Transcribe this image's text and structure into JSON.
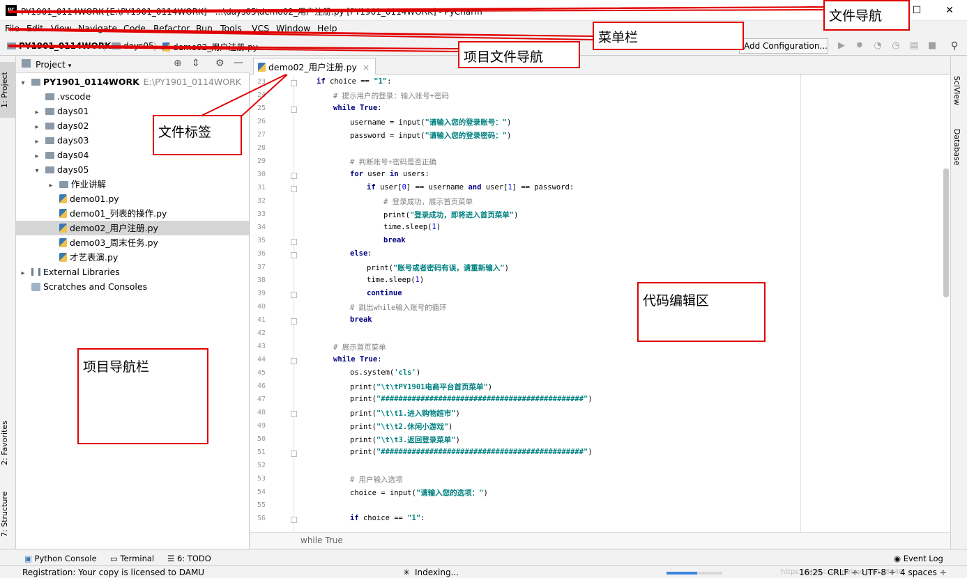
{
  "titlebar": {
    "logo": "PC",
    "title": "PY1901_0114WORK [E:\\PY1901_0114WORK] - ...\\days05\\demo02_用户注册.py [PY1901_0114WORK] - PyCharm",
    "minimize": "—",
    "maximize": "☐",
    "close": "✕"
  },
  "menu": [
    "File",
    "Edit",
    "View",
    "Navigate",
    "Code",
    "Refactor",
    "Run",
    "Tools",
    "VCS",
    "Window",
    "Help"
  ],
  "navbar": {
    "crumbs": [
      "PY1901_0114WORK",
      "days05",
      "demo02_用户注册.py"
    ],
    "run_config": "Add Configuration...",
    "icons": [
      "run-icon",
      "debug-icon",
      "coverage-icon",
      "profile-icon",
      "concurrency-icon",
      "stop-icon",
      "search-icon"
    ]
  },
  "left_stripe": {
    "project_tab": "1: Project",
    "favorites_tab": "2: Favorites",
    "structure_tab": "7: Structure"
  },
  "project": {
    "header_label": "Project",
    "tree": [
      {
        "label": "PY1901_0114WORK",
        "hint": "E:\\PY1901_0114WORK",
        "depth": 0,
        "arrow": "▾",
        "icon": "folder"
      },
      {
        "label": ".vscode",
        "depth": 1,
        "arrow": "",
        "icon": "folder"
      },
      {
        "label": "days01",
        "depth": 1,
        "arrow": "▸",
        "icon": "folder"
      },
      {
        "label": "days02",
        "depth": 1,
        "arrow": "▸",
        "icon": "folder"
      },
      {
        "label": "days03",
        "depth": 1,
        "arrow": "▸",
        "icon": "folder"
      },
      {
        "label": "days04",
        "depth": 1,
        "arrow": "▸",
        "icon": "folder"
      },
      {
        "label": "days05",
        "depth": 1,
        "arrow": "▾",
        "icon": "folder"
      },
      {
        "label": "作业讲解",
        "depth": 2,
        "arrow": "▸",
        "icon": "folder"
      },
      {
        "label": "demo01.py",
        "depth": 2,
        "arrow": "",
        "icon": "py"
      },
      {
        "label": "demo01_列表的操作.py",
        "depth": 2,
        "arrow": "",
        "icon": "py"
      },
      {
        "label": "demo02_用户注册.py",
        "depth": 2,
        "arrow": "",
        "icon": "py",
        "selected": true
      },
      {
        "label": "demo03_周末任务.py",
        "depth": 2,
        "arrow": "",
        "icon": "py"
      },
      {
        "label": "才艺表演.py",
        "depth": 2,
        "arrow": "",
        "icon": "py"
      },
      {
        "label": "External Libraries",
        "depth": 0,
        "arrow": "▸",
        "icon": "lib"
      },
      {
        "label": "Scratches and Consoles",
        "depth": 0,
        "arrow": "",
        "icon": "scratch"
      }
    ]
  },
  "editor": {
    "tab_label": "demo02_用户注册.py",
    "tab_close": "×",
    "breadcrumb": "while True",
    "lines": [
      {
        "n": "23",
        "ind": 4,
        "html": "<span class=\"kw\">if</span> choice == <span class=\"str\">\"1\"</span>:"
      },
      {
        "n": "24",
        "ind": 8,
        "html": "<span class=\"cmt\"># 提示用户的登录：输入账号+密码</span>"
      },
      {
        "n": "25",
        "ind": 8,
        "html": "<span class=\"kw\">while</span> <span class=\"kw\">True</span>:"
      },
      {
        "n": "26",
        "ind": 12,
        "html": "username = input(<span class=\"str\">\"请输入您的登录账号：\"</span>)"
      },
      {
        "n": "27",
        "ind": 12,
        "html": "password = input(<span class=\"str\">\"请输入您的登录密码：\"</span>)"
      },
      {
        "n": "28",
        "ind": 0,
        "html": ""
      },
      {
        "n": "29",
        "ind": 12,
        "html": "<span class=\"cmt\"># 判断账号+密码是否正确</span>"
      },
      {
        "n": "30",
        "ind": 12,
        "html": "<span class=\"kw\">for</span> user <span class=\"kw\">in</span> users:"
      },
      {
        "n": "31",
        "ind": 16,
        "html": "<span class=\"kw\">if</span> user[<span class=\"num\">0</span>] == username <span class=\"kw\">and</span> user[<span class=\"num\">1</span>] == password:"
      },
      {
        "n": "32",
        "ind": 20,
        "html": "<span class=\"cmt\"># 登录成功，展示首页菜单</span>"
      },
      {
        "n": "33",
        "ind": 20,
        "html": "print(<span class=\"str\">\"登录成功，即将进入首页菜单\"</span>)"
      },
      {
        "n": "34",
        "ind": 20,
        "html": "time.sleep(<span class=\"num\">1</span>)"
      },
      {
        "n": "35",
        "ind": 20,
        "html": "<span class=\"kw\">break</span>"
      },
      {
        "n": "36",
        "ind": 12,
        "html": "<span class=\"kw\">else</span>:"
      },
      {
        "n": "37",
        "ind": 16,
        "html": "print(<span class=\"str\">\"账号或者密码有误，请重新输入\"</span>)"
      },
      {
        "n": "38",
        "ind": 16,
        "html": "time.sleep(<span class=\"num\">1</span>)"
      },
      {
        "n": "39",
        "ind": 16,
        "html": "<span class=\"kw\">continue</span>"
      },
      {
        "n": "40",
        "ind": 12,
        "html": "<span class=\"cmt\"># 跳出while输入账号的循环</span>"
      },
      {
        "n": "41",
        "ind": 12,
        "html": "<span class=\"kw\">break</span>"
      },
      {
        "n": "42",
        "ind": 0,
        "html": ""
      },
      {
        "n": "43",
        "ind": 8,
        "html": "<span class=\"cmt\"># 展示首页菜单</span>"
      },
      {
        "n": "44",
        "ind": 8,
        "html": "<span class=\"kw\">while</span> <span class=\"kw\">True</span>:"
      },
      {
        "n": "45",
        "ind": 12,
        "html": "os.system(<span class=\"str\">'cls'</span>)"
      },
      {
        "n": "46",
        "ind": 12,
        "html": "print(<span class=\"str\">\"\\t\\tPY1901电商平台首页菜单\"</span>)"
      },
      {
        "n": "47",
        "ind": 12,
        "html": "print(<span class=\"str\">\"##############################################\"</span>)"
      },
      {
        "n": "48",
        "ind": 12,
        "html": "print(<span class=\"str\">\"\\t\\t1.进入购物超市\"</span>)"
      },
      {
        "n": "49",
        "ind": 12,
        "html": "print(<span class=\"str\">\"\\t\\t2.休闲小游戏\"</span>)"
      },
      {
        "n": "50",
        "ind": 12,
        "html": "print(<span class=\"str\">\"\\t\\t3.返回登录菜单\"</span>)"
      },
      {
        "n": "51",
        "ind": 12,
        "html": "print(<span class=\"str\">\"##############################################\"</span>)"
      },
      {
        "n": "52",
        "ind": 0,
        "html": ""
      },
      {
        "n": "53",
        "ind": 12,
        "html": "<span class=\"cmt\"># 用户输入选项</span>"
      },
      {
        "n": "54",
        "ind": 12,
        "html": "choice = input(<span class=\"str\">\"请输入您的选项：\"</span>)"
      },
      {
        "n": "55",
        "ind": 0,
        "html": ""
      },
      {
        "n": "56",
        "ind": 12,
        "html": "<span class=\"kw\">if</span> choice == <span class=\"str\">\"1\"</span>:"
      }
    ]
  },
  "right_stripe": {
    "sciview": "SciView",
    "database": "Database"
  },
  "bottom_tools": [
    {
      "label": "Python Console",
      "icon": "python-console-icon"
    },
    {
      "label": "Terminal",
      "icon": "terminal-icon"
    },
    {
      "label": "6: TODO",
      "icon": "todo-icon"
    },
    {
      "label": "Event Log",
      "icon": "event-log-icon"
    }
  ],
  "status": {
    "message": "Registration: Your copy is licensed to DAMU",
    "indexing": "Indexing...",
    "indexing_progress": 0.55,
    "position": "16:25",
    "line_sep": "CRLF ÷",
    "encoding": "UTF-8 ÷",
    "indent": "4 spaces ÷",
    "watermark": "https://blog.csdn.net/qq_40138840"
  },
  "annotations": {
    "file_nav": "文件导航",
    "menu_bar": "菜单栏",
    "project_file_nav": "项目文件导航",
    "file_tab": "文件标签",
    "editor_area": "代码编辑区",
    "project_nav_bar": "项目导航栏"
  },
  "colors": {
    "annotation_red": "#e00000",
    "selection": "#d5d5d5",
    "keyword": "#000080",
    "string": "#008080",
    "comment": "#808080"
  }
}
